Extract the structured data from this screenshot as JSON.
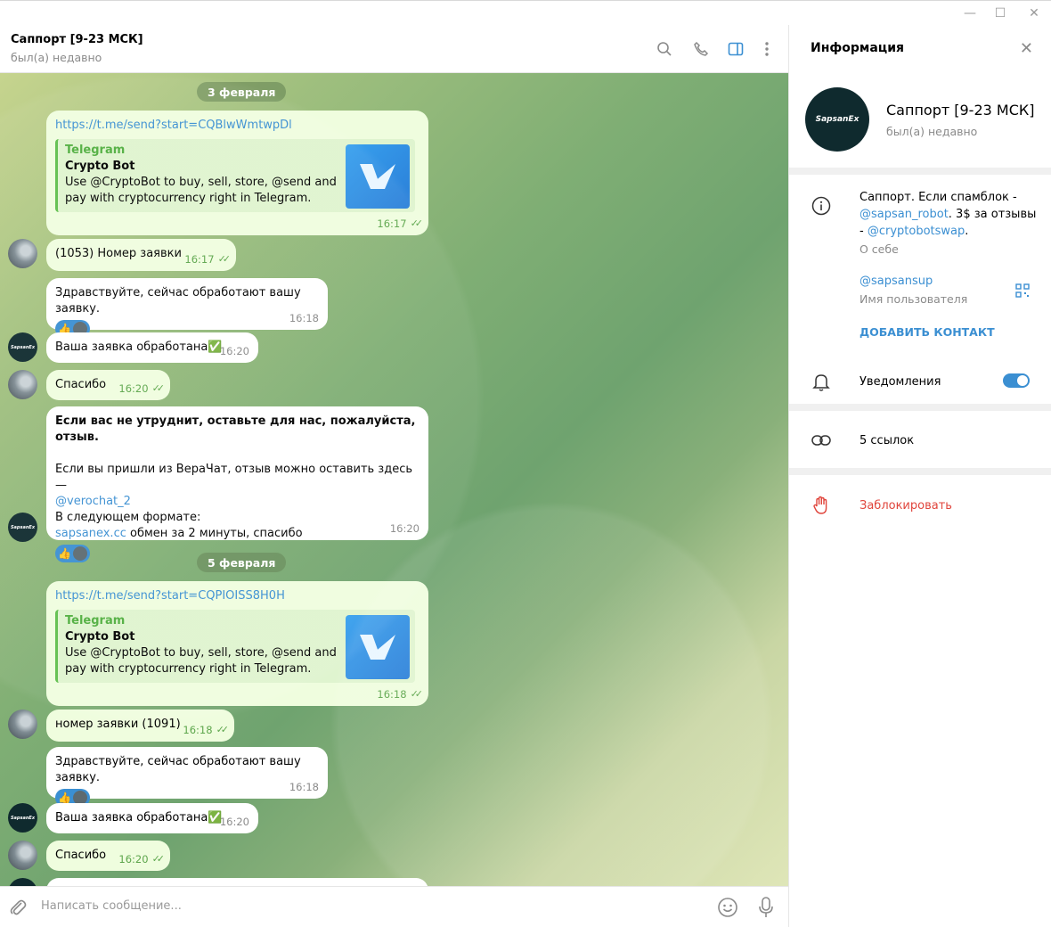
{
  "header": {
    "title": "Саппорт [9-23 МСК]",
    "status": "был(а) недавно"
  },
  "dates": [
    "3 февраля",
    "5 февраля"
  ],
  "messages": {
    "m1": {
      "link": "https://t.me/send?start=CQBlwWmtwpDl",
      "preview_site": "Telegram",
      "preview_title": "Crypto Bot",
      "preview_desc": "Use @CryptoBot to buy, sell, store, @send and pay with cryptocurrency right in Telegram.",
      "time": "16:17"
    },
    "m2": {
      "text": "(1053) Номер заявки",
      "time": "16:17"
    },
    "m3": {
      "text": "Здравствуйте, сейчас обработают вашу заявку.",
      "time": "16:18",
      "reaction": "👍"
    },
    "m4": {
      "text": "Ваша заявка обработана✅",
      "time": "16:20"
    },
    "m5": {
      "text": "Спасибо",
      "time": "16:20"
    },
    "m6": {
      "bold": "Если вас не утруднит, оставьте для нас, пожалуйста, отзыв.",
      "line1": "Если вы пришли из ВераЧат, отзыв можно оставить здесь —",
      "link1": "@verochat_2",
      "line2": "В следующем формате:",
      "link2": "sapsanex.cc",
      "line3": " обмен за 2 минуты, спасибо",
      "time": "16:20",
      "reaction": "👍"
    },
    "m7": {
      "link": "https://t.me/send?start=CQPIOISS8H0H",
      "preview_site": "Telegram",
      "preview_title": "Crypto Bot",
      "preview_desc": "Use @CryptoBot to buy, sell, store, @send and pay with cryptocurrency right in Telegram.",
      "time": "16:18"
    },
    "m8": {
      "text": "номер заявки (1091)",
      "time": "16:18"
    },
    "m9": {
      "text": "Здравствуйте, сейчас обработают вашу заявку.",
      "time": "16:18",
      "reaction": "👍"
    },
    "m10": {
      "text": "Ваша заявка обработана✅",
      "time": "16:20"
    },
    "m11": {
      "text": "Спасибо",
      "time": "16:20"
    }
  },
  "composer": {
    "placeholder": "Написать сообщение..."
  },
  "info": {
    "title": "Информация",
    "avatar_text": "SapsanEx",
    "name": "Саппорт [9-23 МСК]",
    "status": "был(а) недавно",
    "bio_1": "Саппорт. Если спамблок -",
    "bio_link1": "@sapsan_robot",
    "bio_2": ". 3$ за отзывы",
    "bio_3": "- ",
    "bio_link2": "@cryptobotswap",
    "bio_4": ".",
    "bio_label": "О себе",
    "username": "@sapsansup",
    "username_label": "Имя пользователя",
    "add_contact": "ДОБАВИТЬ КОНТАКТ",
    "notifications": "Уведомления",
    "notifications_on": true,
    "links": "5 ссылок",
    "block": "Заблокировать"
  },
  "colors": {
    "accent": "#3b8fd2",
    "out_bubble": "#effdde",
    "danger": "#e0453c",
    "green": "#5da64c"
  }
}
